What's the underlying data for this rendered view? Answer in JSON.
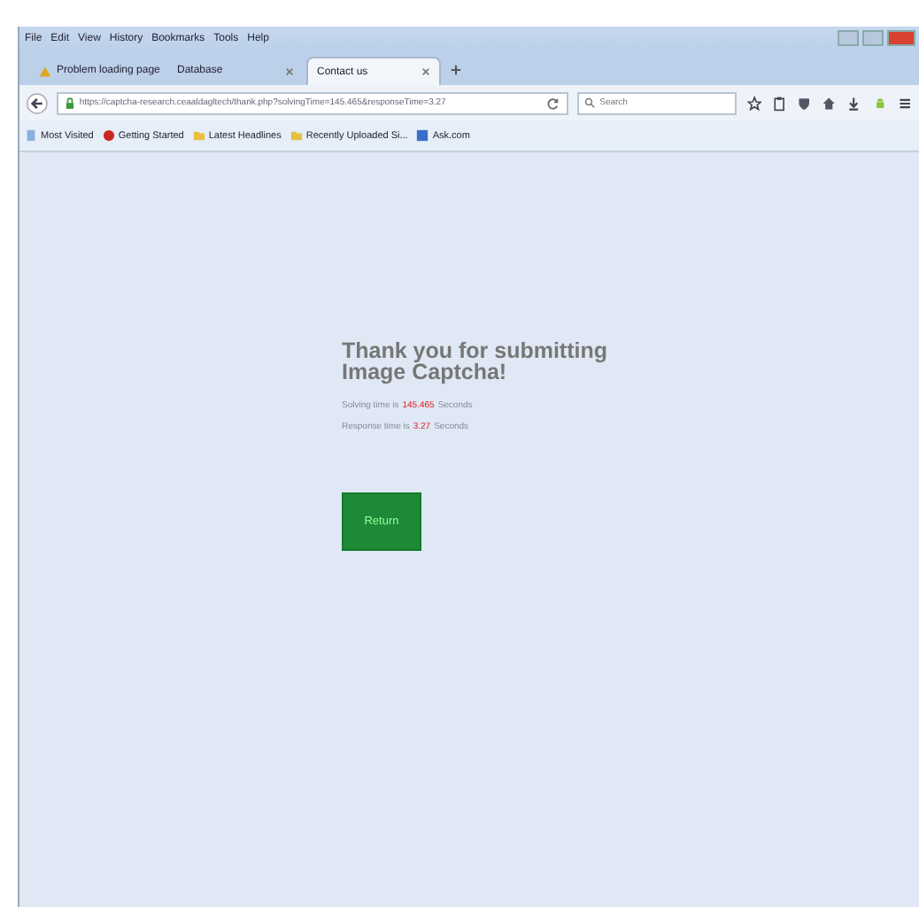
{
  "menu": [
    "File",
    "Edit",
    "View",
    "History",
    "Bookmarks",
    "Tools",
    "Help"
  ],
  "tabs": [
    {
      "label": "Problem loading page",
      "kind": "warning",
      "selected": false
    },
    {
      "label": "Database",
      "kind": "plain",
      "selected": false
    },
    {
      "label": "Contact us",
      "kind": "plain",
      "selected": true
    }
  ],
  "address": {
    "value": "https://captcha-research.ceaaldagltech/thank.php?solvingTime=145.465&responseTime=3.27"
  },
  "search": {
    "placeholder": "Search"
  },
  "bookmarks": [
    {
      "label": "Most Visited",
      "kind": "page"
    },
    {
      "label": "Getting Started",
      "kind": "site"
    },
    {
      "label": "Latest Headlines",
      "kind": "folder"
    },
    {
      "label": "Recently Uploaded Si...",
      "kind": "folder"
    },
    {
      "label": "Ask.com",
      "kind": "link"
    }
  ],
  "page": {
    "title": "Thank you for submitting Image Captcha!",
    "stats": [
      {
        "label": "Solving time is",
        "value": "145.465",
        "unit": "Seconds"
      },
      {
        "label": "Response time is",
        "value": "3.27",
        "unit": "Seconds"
      }
    ],
    "button": "Return"
  }
}
